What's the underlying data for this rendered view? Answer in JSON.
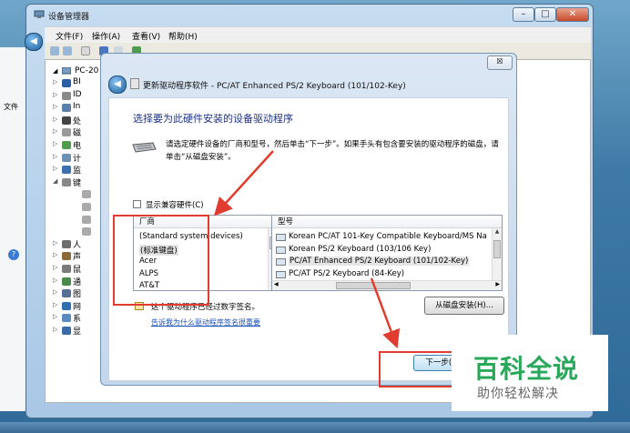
{
  "device_manager": {
    "title": "设备管理器",
    "menu": [
      "文件(F)",
      "操作(A)",
      "查看(V)",
      "帮助(H)"
    ],
    "tree_root": "PC-20",
    "tree_items": [
      "BI",
      "ID",
      "In",
      "处",
      "磁",
      "电",
      "计",
      "监",
      "键",
      "",
      "",
      "",
      "",
      "人",
      "声",
      "鼠",
      "通",
      "图",
      "网",
      "系",
      "显"
    ],
    "background_window_menu": "文件"
  },
  "dialog": {
    "title": "更新驱动程序软件 - PC/AT Enhanced PS/2 Keyboard (101/102-Key)",
    "close_label": "☒",
    "heading": "选择要为此硬件安装的设备驱动程序",
    "instruction": "请选定硬件设备的厂商和型号，然后单击“下一步”。如果手头有包含要安装的驱动程序的磁盘，请单击“从磁盘安装”。",
    "compat_label": "显示兼容硬件(C)",
    "manufacturer_header": "厂商",
    "manufacturers": [
      "(Standard system devices)",
      "(标准键盘)",
      "Acer",
      "ALPS",
      "AT&T"
    ],
    "selected_manufacturer_index": 1,
    "model_header": "型号",
    "models": [
      "Korean PC/AT 101-Key Compatible Keyboard/MS Na",
      "Korean PS/2 Keyboard (103/106 Key)",
      "PC/AT Enhanced PS/2 Keyboard (101/102-Key)",
      "PC/AT PS/2 Keyboard (84-Key)"
    ],
    "selected_model_index": 2,
    "signed_text": "这个驱动程序已经过数字签名。",
    "signed_link": "告诉我为什么驱动程序签名很重要",
    "from_disk_label": "从磁盘安装(H)...",
    "next_label": "下一步(N"
  },
  "watermark": {
    "main": "百科全说",
    "sub": "助你轻松解决"
  },
  "colors": {
    "heading": "#1e3287",
    "annotation": "#e23b2f",
    "watermark_green": "#2aa85a",
    "link": "#1a4fb6"
  }
}
